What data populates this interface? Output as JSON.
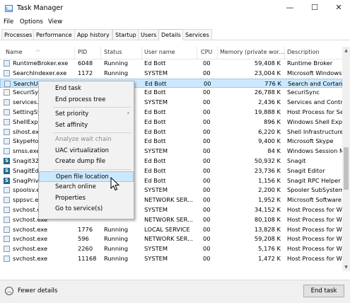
{
  "window": {
    "title": "Task Manager",
    "minimize": "—",
    "maximize": "☐",
    "close": "✕"
  },
  "menu": [
    "File",
    "Options",
    "View"
  ],
  "tabs": [
    "Processes",
    "Performance",
    "App history",
    "Startup",
    "Users",
    "Details",
    "Services"
  ],
  "active_tab": "Details",
  "columns": [
    "Name",
    "PID",
    "Status",
    "User name",
    "CPU",
    "Memory (private wor...",
    "Description"
  ],
  "rows": [
    {
      "name": "RuntimeBroker.exe",
      "pid": "6048",
      "status": "Running",
      "user": "Ed Bott",
      "cpu": "00",
      "mem": "59,408 K",
      "desc": "Runtime Broker",
      "icon": "box"
    },
    {
      "name": "SearchIndexer.exe",
      "pid": "1172",
      "status": "Running",
      "user": "SYSTEM",
      "cpu": "00",
      "mem": "23,004 K",
      "desc": "Microsoft Windows",
      "icon": "box"
    },
    {
      "name": "SearchUI...",
      "pid": "",
      "status": "",
      "user": "Ed Bott",
      "cpu": "00",
      "mem": "776 K",
      "desc": "Search and Cortana",
      "icon": "box",
      "selected": true
    },
    {
      "name": "SecuriSyn...",
      "pid": "",
      "status": "",
      "user": "Ed Bott",
      "cpu": "00",
      "mem": "26,788 K",
      "desc": "SecuriSync",
      "icon": "win"
    },
    {
      "name": "services.e...",
      "pid": "",
      "status": "",
      "user": "SYSTEM",
      "cpu": "00",
      "mem": "2,436 K",
      "desc": "Services and Contro",
      "icon": "box"
    },
    {
      "name": "SettingSy...",
      "pid": "",
      "status": "",
      "user": "Ed Bott",
      "cpu": "00",
      "mem": "19,888 K",
      "desc": "Host Process for Set",
      "icon": "box"
    },
    {
      "name": "ShellExpe...",
      "pid": "",
      "status": "",
      "user": "Ed Bott",
      "cpu": "00",
      "mem": "896 K",
      "desc": "Windows Shell Expe",
      "icon": "box"
    },
    {
      "name": "sihost.ex...",
      "pid": "",
      "status": "",
      "user": "Ed Bott",
      "cpu": "00",
      "mem": "6,220 K",
      "desc": "Shell Infrastructure H",
      "icon": "box"
    },
    {
      "name": "SkypeHos...",
      "pid": "",
      "status": "",
      "user": "Ed Bott",
      "cpu": "00",
      "mem": "9,400 K",
      "desc": "Microsoft Skype",
      "icon": "box"
    },
    {
      "name": "smss.exe",
      "pid": "",
      "status": "",
      "user": "SYSTEM",
      "cpu": "00",
      "mem": "84 K",
      "desc": "Windows Session M",
      "icon": "box"
    },
    {
      "name": "Snagit32...",
      "pid": "",
      "status": "",
      "user": "Ed Bott",
      "cpu": "00",
      "mem": "50,932 K",
      "desc": "Snagit",
      "icon": "snag"
    },
    {
      "name": "SnagitEdi...",
      "pid": "",
      "status": "",
      "user": "Ed Bott",
      "cpu": "00",
      "mem": "23,736 K",
      "desc": "Snagit Editor",
      "icon": "snag"
    },
    {
      "name": "SnagPriv...",
      "pid": "",
      "status": "",
      "user": "Ed Bott",
      "cpu": "00",
      "mem": "1,156 K",
      "desc": "Snagit RPC Helper",
      "icon": "snag"
    },
    {
      "name": "spoolsv.e...",
      "pid": "",
      "status": "",
      "user": "SYSTEM",
      "cpu": "00",
      "mem": "2,200 K",
      "desc": "Spooler SubSystem",
      "icon": "box"
    },
    {
      "name": "sppsvc.ex...",
      "pid": "",
      "status": "",
      "user": "NETWORK SER...",
      "cpu": "00",
      "mem": "1,952 K",
      "desc": "Microsoft Software",
      "icon": "box"
    },
    {
      "name": "svchost.exe",
      "pid": "",
      "status": "",
      "user": "SYSTEM",
      "cpu": "00",
      "mem": "34,152 K",
      "desc": "Host Process for Wir",
      "icon": "box"
    },
    {
      "name": "svchost.exe",
      "pid": "",
      "status": "",
      "user": "NETWORK SER...",
      "cpu": "00",
      "mem": "80,108 K",
      "desc": "Host Process for Wir",
      "icon": "box"
    },
    {
      "name": "svchost.exe",
      "pid": "1776",
      "status": "Running",
      "user": "LOCAL SERVICE",
      "cpu": "00",
      "mem": "13,828 K",
      "desc": "Host Process for Wir",
      "icon": "box"
    },
    {
      "name": "svchost.exe",
      "pid": "596",
      "status": "Running",
      "user": "NETWORK SER...",
      "cpu": "00",
      "mem": "59,208 K",
      "desc": "Host Process for Wir",
      "icon": "box"
    },
    {
      "name": "svchost.exe",
      "pid": "2260",
      "status": "Running",
      "user": "SYSTEM",
      "cpu": "00",
      "mem": "5,176 K",
      "desc": "Host Process for Wir",
      "icon": "box"
    },
    {
      "name": "svchost.exe",
      "pid": "11168",
      "status": "Running",
      "user": "SYSTEM",
      "cpu": "00",
      "mem": "1,472 K",
      "desc": "Host Process for Wir",
      "icon": "box"
    }
  ],
  "context_menu": {
    "items": [
      {
        "label": "End task",
        "disabled": false
      },
      {
        "label": "End process tree",
        "disabled": false
      },
      {
        "sep": true
      },
      {
        "label": "Set priority",
        "disabled": false,
        "submenu": true
      },
      {
        "label": "Set affinity",
        "disabled": false
      },
      {
        "sep": true
      },
      {
        "label": "Analyze wait chain",
        "disabled": true
      },
      {
        "label": "UAC virtualization",
        "disabled": false
      },
      {
        "label": "Create dump file",
        "disabled": false
      },
      {
        "sep": true
      },
      {
        "label": "Open file location",
        "disabled": false,
        "highlighted": true
      },
      {
        "label": "Search online",
        "disabled": false
      },
      {
        "label": "Properties",
        "disabled": false
      },
      {
        "label": "Go to service(s)",
        "disabled": false
      }
    ]
  },
  "footer": {
    "fewer_details": "Fewer details",
    "end_task": "End task"
  },
  "icons": {
    "app": "task-manager-icon",
    "fewer": "chevron-up-icon",
    "cursor": "mouse-pointer-icon"
  }
}
